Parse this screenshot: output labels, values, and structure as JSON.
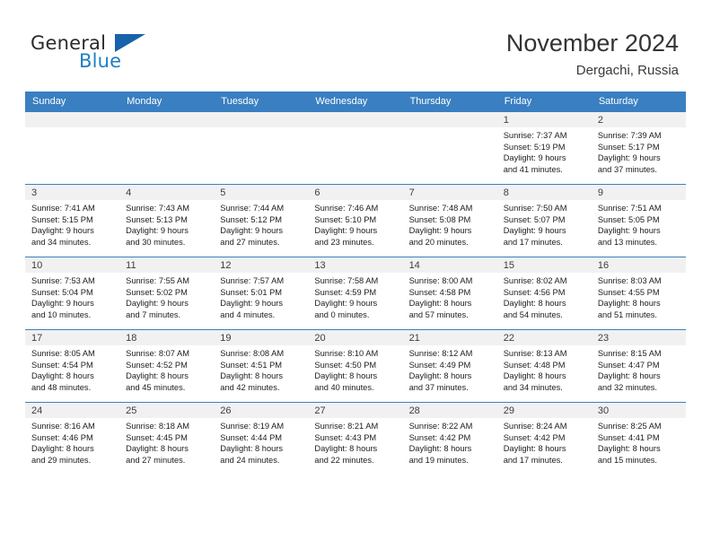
{
  "brand": {
    "name_part1": "General",
    "name_part2": "Blue",
    "flag_icon": "triangle-flag-icon"
  },
  "header": {
    "title": "November 2024",
    "location": "Dergachi, Russia"
  },
  "colors": {
    "header_row_bg": "#3a7fc1",
    "brand_blue": "#1f7fc4",
    "flag_blue": "#1862ab",
    "daynum_bg": "#f1f1f1"
  },
  "weekdays": [
    "Sunday",
    "Monday",
    "Tuesday",
    "Wednesday",
    "Thursday",
    "Friday",
    "Saturday"
  ],
  "labels": {
    "sunrise_prefix": "Sunrise:",
    "sunset_prefix": "Sunset:",
    "daylight_prefix": "Daylight:"
  },
  "weeks": [
    [
      {
        "empty": true
      },
      {
        "empty": true
      },
      {
        "empty": true
      },
      {
        "empty": true
      },
      {
        "empty": true
      },
      {
        "empty": false,
        "day": "1",
        "sunrise": "Sunrise: 7:37 AM",
        "sunset": "Sunset: 5:19 PM",
        "daylight_line1": "Daylight: 9 hours",
        "daylight_line2": "and 41 minutes."
      },
      {
        "empty": false,
        "day": "2",
        "sunrise": "Sunrise: 7:39 AM",
        "sunset": "Sunset: 5:17 PM",
        "daylight_line1": "Daylight: 9 hours",
        "daylight_line2": "and 37 minutes."
      }
    ],
    [
      {
        "empty": false,
        "day": "3",
        "sunrise": "Sunrise: 7:41 AM",
        "sunset": "Sunset: 5:15 PM",
        "daylight_line1": "Daylight: 9 hours",
        "daylight_line2": "and 34 minutes."
      },
      {
        "empty": false,
        "day": "4",
        "sunrise": "Sunrise: 7:43 AM",
        "sunset": "Sunset: 5:13 PM",
        "daylight_line1": "Daylight: 9 hours",
        "daylight_line2": "and 30 minutes."
      },
      {
        "empty": false,
        "day": "5",
        "sunrise": "Sunrise: 7:44 AM",
        "sunset": "Sunset: 5:12 PM",
        "daylight_line1": "Daylight: 9 hours",
        "daylight_line2": "and 27 minutes."
      },
      {
        "empty": false,
        "day": "6",
        "sunrise": "Sunrise: 7:46 AM",
        "sunset": "Sunset: 5:10 PM",
        "daylight_line1": "Daylight: 9 hours",
        "daylight_line2": "and 23 minutes."
      },
      {
        "empty": false,
        "day": "7",
        "sunrise": "Sunrise: 7:48 AM",
        "sunset": "Sunset: 5:08 PM",
        "daylight_line1": "Daylight: 9 hours",
        "daylight_line2": "and 20 minutes."
      },
      {
        "empty": false,
        "day": "8",
        "sunrise": "Sunrise: 7:50 AM",
        "sunset": "Sunset: 5:07 PM",
        "daylight_line1": "Daylight: 9 hours",
        "daylight_line2": "and 17 minutes."
      },
      {
        "empty": false,
        "day": "9",
        "sunrise": "Sunrise: 7:51 AM",
        "sunset": "Sunset: 5:05 PM",
        "daylight_line1": "Daylight: 9 hours",
        "daylight_line2": "and 13 minutes."
      }
    ],
    [
      {
        "empty": false,
        "day": "10",
        "sunrise": "Sunrise: 7:53 AM",
        "sunset": "Sunset: 5:04 PM",
        "daylight_line1": "Daylight: 9 hours",
        "daylight_line2": "and 10 minutes."
      },
      {
        "empty": false,
        "day": "11",
        "sunrise": "Sunrise: 7:55 AM",
        "sunset": "Sunset: 5:02 PM",
        "daylight_line1": "Daylight: 9 hours",
        "daylight_line2": "and 7 minutes."
      },
      {
        "empty": false,
        "day": "12",
        "sunrise": "Sunrise: 7:57 AM",
        "sunset": "Sunset: 5:01 PM",
        "daylight_line1": "Daylight: 9 hours",
        "daylight_line2": "and 4 minutes."
      },
      {
        "empty": false,
        "day": "13",
        "sunrise": "Sunrise: 7:58 AM",
        "sunset": "Sunset: 4:59 PM",
        "daylight_line1": "Daylight: 9 hours",
        "daylight_line2": "and 0 minutes."
      },
      {
        "empty": false,
        "day": "14",
        "sunrise": "Sunrise: 8:00 AM",
        "sunset": "Sunset: 4:58 PM",
        "daylight_line1": "Daylight: 8 hours",
        "daylight_line2": "and 57 minutes."
      },
      {
        "empty": false,
        "day": "15",
        "sunrise": "Sunrise: 8:02 AM",
        "sunset": "Sunset: 4:56 PM",
        "daylight_line1": "Daylight: 8 hours",
        "daylight_line2": "and 54 minutes."
      },
      {
        "empty": false,
        "day": "16",
        "sunrise": "Sunrise: 8:03 AM",
        "sunset": "Sunset: 4:55 PM",
        "daylight_line1": "Daylight: 8 hours",
        "daylight_line2": "and 51 minutes."
      }
    ],
    [
      {
        "empty": false,
        "day": "17",
        "sunrise": "Sunrise: 8:05 AM",
        "sunset": "Sunset: 4:54 PM",
        "daylight_line1": "Daylight: 8 hours",
        "daylight_line2": "and 48 minutes."
      },
      {
        "empty": false,
        "day": "18",
        "sunrise": "Sunrise: 8:07 AM",
        "sunset": "Sunset: 4:52 PM",
        "daylight_line1": "Daylight: 8 hours",
        "daylight_line2": "and 45 minutes."
      },
      {
        "empty": false,
        "day": "19",
        "sunrise": "Sunrise: 8:08 AM",
        "sunset": "Sunset: 4:51 PM",
        "daylight_line1": "Daylight: 8 hours",
        "daylight_line2": "and 42 minutes."
      },
      {
        "empty": false,
        "day": "20",
        "sunrise": "Sunrise: 8:10 AM",
        "sunset": "Sunset: 4:50 PM",
        "daylight_line1": "Daylight: 8 hours",
        "daylight_line2": "and 40 minutes."
      },
      {
        "empty": false,
        "day": "21",
        "sunrise": "Sunrise: 8:12 AM",
        "sunset": "Sunset: 4:49 PM",
        "daylight_line1": "Daylight: 8 hours",
        "daylight_line2": "and 37 minutes."
      },
      {
        "empty": false,
        "day": "22",
        "sunrise": "Sunrise: 8:13 AM",
        "sunset": "Sunset: 4:48 PM",
        "daylight_line1": "Daylight: 8 hours",
        "daylight_line2": "and 34 minutes."
      },
      {
        "empty": false,
        "day": "23",
        "sunrise": "Sunrise: 8:15 AM",
        "sunset": "Sunset: 4:47 PM",
        "daylight_line1": "Daylight: 8 hours",
        "daylight_line2": "and 32 minutes."
      }
    ],
    [
      {
        "empty": false,
        "day": "24",
        "sunrise": "Sunrise: 8:16 AM",
        "sunset": "Sunset: 4:46 PM",
        "daylight_line1": "Daylight: 8 hours",
        "daylight_line2": "and 29 minutes."
      },
      {
        "empty": false,
        "day": "25",
        "sunrise": "Sunrise: 8:18 AM",
        "sunset": "Sunset: 4:45 PM",
        "daylight_line1": "Daylight: 8 hours",
        "daylight_line2": "and 27 minutes."
      },
      {
        "empty": false,
        "day": "26",
        "sunrise": "Sunrise: 8:19 AM",
        "sunset": "Sunset: 4:44 PM",
        "daylight_line1": "Daylight: 8 hours",
        "daylight_line2": "and 24 minutes."
      },
      {
        "empty": false,
        "day": "27",
        "sunrise": "Sunrise: 8:21 AM",
        "sunset": "Sunset: 4:43 PM",
        "daylight_line1": "Daylight: 8 hours",
        "daylight_line2": "and 22 minutes."
      },
      {
        "empty": false,
        "day": "28",
        "sunrise": "Sunrise: 8:22 AM",
        "sunset": "Sunset: 4:42 PM",
        "daylight_line1": "Daylight: 8 hours",
        "daylight_line2": "and 19 minutes."
      },
      {
        "empty": false,
        "day": "29",
        "sunrise": "Sunrise: 8:24 AM",
        "sunset": "Sunset: 4:42 PM",
        "daylight_line1": "Daylight: 8 hours",
        "daylight_line2": "and 17 minutes."
      },
      {
        "empty": false,
        "day": "30",
        "sunrise": "Sunrise: 8:25 AM",
        "sunset": "Sunset: 4:41 PM",
        "daylight_line1": "Daylight: 8 hours",
        "daylight_line2": "and 15 minutes."
      }
    ]
  ]
}
